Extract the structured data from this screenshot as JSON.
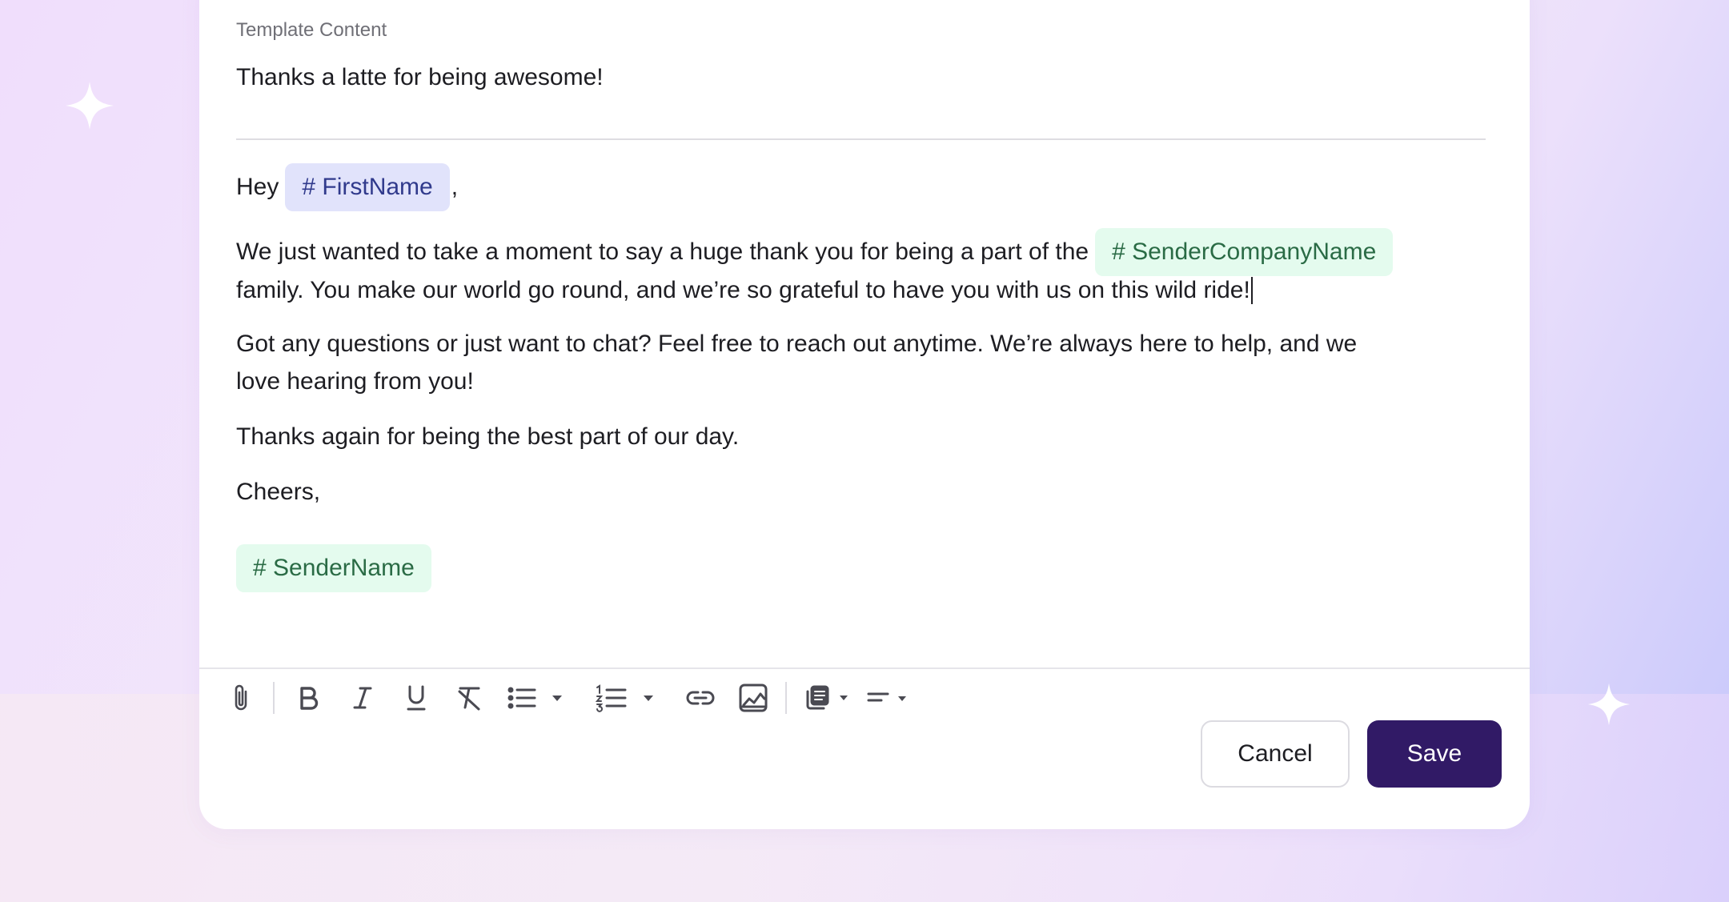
{
  "editor": {
    "section_label": "Template Content",
    "subject": "Thanks a latte for being awesome!",
    "greeting": "Hey",
    "greeting_comma": ",",
    "first_name_tag": "# FirstName",
    "paragraph1_line1": "We just wanted to take a moment to say a huge thank you for being a part of the",
    "company_tag": "# SenderCompanyName",
    "paragraph1_line2": "family. You make our world go round, and we’re so grateful to have you with us on this wild ride!",
    "paragraph2_line1": "Got any questions or just want to chat? Feel free to reach out anytime. We’re always here to help, and we",
    "paragraph2_line2": "love hearing from you!",
    "paragraph3": "Thanks again for being the best part of our day.",
    "signoff": "Cheers,",
    "sender_tag": "# SenderName"
  },
  "toolbar": {
    "icons": [
      "paperclip-icon",
      "bold-icon",
      "italic-icon",
      "underline-icon",
      "clear-format-icon",
      "bullet-list-icon",
      "numbered-list-icon",
      "link-icon",
      "image-icon",
      "template-blocks-icon",
      "align-icon"
    ]
  },
  "actions": {
    "cancel_label": "Cancel",
    "save_label": "Save"
  },
  "colors": {
    "save_button": "#311a66",
    "first_name_tag_bg": "#e1e3fb",
    "sender_tag_bg": "#e4fbee"
  }
}
